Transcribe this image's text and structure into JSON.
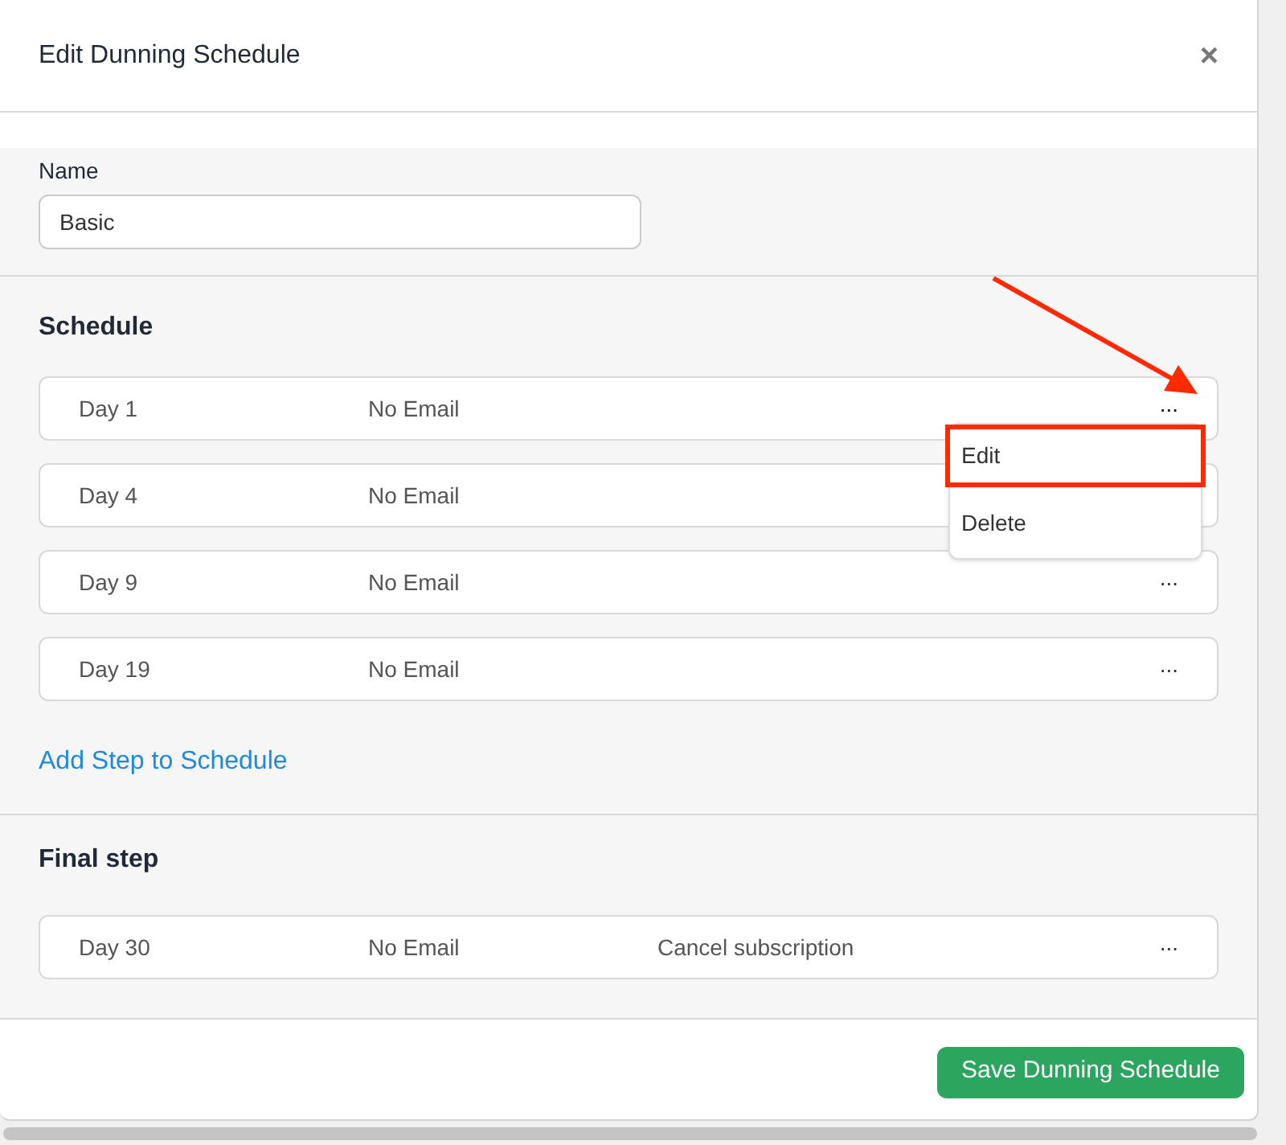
{
  "dialog": {
    "title": "Edit Dunning Schedule",
    "close": "×"
  },
  "name_field": {
    "label": "Name",
    "value": "Basic"
  },
  "schedule": {
    "heading": "Schedule",
    "steps": [
      {
        "day": "Day 1",
        "email": "No Email",
        "more": "...",
        "menu_open": true
      },
      {
        "day": "Day 4",
        "email": "No Email",
        "menu_open": false
      },
      {
        "day": "Day 9",
        "email": "No Email",
        "more": "...",
        "menu_open": false
      },
      {
        "day": "Day 19",
        "email": "No Email",
        "more": "...",
        "menu_open": false
      }
    ],
    "add_link": "Add Step to Schedule"
  },
  "menu": {
    "items": [
      {
        "label": "Edit",
        "highlighted": true
      },
      {
        "label": "Delete",
        "highlighted": false
      }
    ]
  },
  "annotation": {
    "kind": "arrow"
  },
  "final_step": {
    "heading": "Final step",
    "day": "Day 30",
    "email": "No Email",
    "action": "Cancel subscription",
    "more": "..."
  },
  "footer": {
    "save": "Save Dunning Schedule"
  }
}
